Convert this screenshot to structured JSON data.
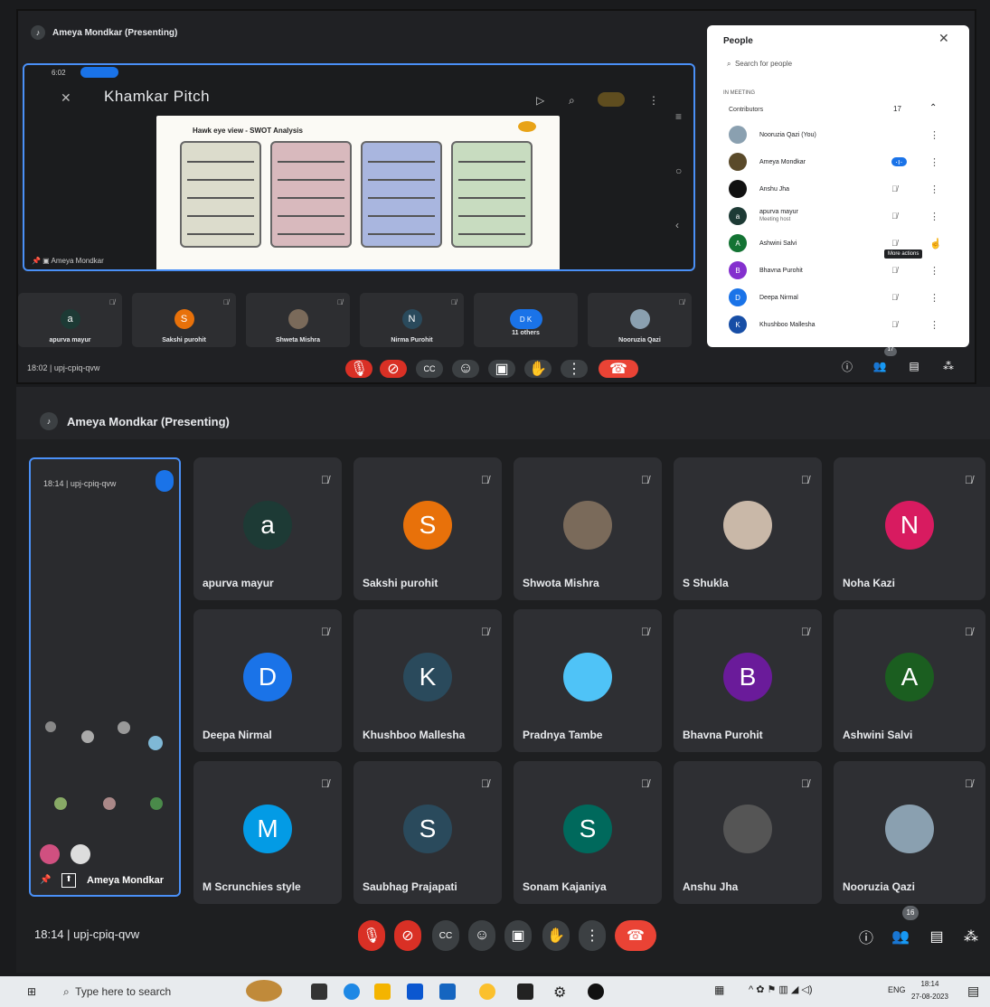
{
  "top": {
    "presenter_title": "Ameya Mondkar (Presenting)",
    "status_time": "6:02",
    "presentation_title": "Khamkar Pitch",
    "slide_title": "Hawk eye view - SWOT Analysis",
    "presenter_name": "Ameya Mondkar",
    "meeting_info": "18:02 | upj-cpiq-qvw",
    "tiles": [
      {
        "name": "apurva mayur",
        "initial": "a",
        "color": "#1d3a35"
      },
      {
        "name": "Sakshi purohit",
        "initial": "S",
        "color": "#e8710a"
      },
      {
        "name": "Shweta Mishra",
        "initial": "",
        "color": "#7a6a5a"
      },
      {
        "name": "Nirma Purohit",
        "initial": "N",
        "color": "#2a4a5c"
      },
      {
        "name": "11 others",
        "initial": "D K",
        "color": "#1a73e8"
      },
      {
        "name": "Nooruzia Qazi",
        "initial": "",
        "color": "#8aa0b0"
      }
    ],
    "people_count": "17"
  },
  "people": {
    "title": "People",
    "search_placeholder": "Search for people",
    "section": "IN MEETING",
    "group": "Contributors",
    "count": "17",
    "tooltip": "More actions",
    "rows": [
      {
        "name": "Nooruzia Qazi (You)",
        "initial": "",
        "color": "#8aa0b0"
      },
      {
        "name": "Ameya Mondkar",
        "initial": "",
        "color": "#5a4a2a"
      },
      {
        "name": "Anshu Jha",
        "initial": "",
        "color": "#111111"
      },
      {
        "name": "apurva mayur",
        "initial": "a",
        "color": "#1d3a35",
        "sub": "Meeting host"
      },
      {
        "name": "Ashwini Salvi",
        "initial": "A",
        "color": "#137333"
      },
      {
        "name": "Bhavna Purohit",
        "initial": "B",
        "color": "#8430ce"
      },
      {
        "name": "Deepa Nirmal",
        "initial": "D",
        "color": "#1a73e8"
      },
      {
        "name": "Khushboo Mallesha",
        "initial": "K",
        "color": "#174ea6"
      }
    ]
  },
  "bottom": {
    "presenter_title": "Ameya Mondkar (Presenting)",
    "screen_owner": "Ameya Mondkar",
    "meeting_info": "18:14 | upj-cpiq-qvw",
    "people_count": "16",
    "tiles": [
      {
        "name": "apurva mayur",
        "initial": "a",
        "color": "#1d3a35"
      },
      {
        "name": "Sakshi purohit",
        "initial": "S",
        "color": "#e8710a"
      },
      {
        "name": "Shwota Mishra",
        "initial": "",
        "color": "#7a6a5a"
      },
      {
        "name": "S Shukla",
        "initial": "",
        "color": "#c9b8a8"
      },
      {
        "name": "Noha Kazi",
        "initial": "N",
        "color": "#d81b60"
      },
      {
        "name": "Deepa Nirmal",
        "initial": "D",
        "color": "#1a73e8"
      },
      {
        "name": "Khushboo Mallesha",
        "initial": "K",
        "color": "#2a4a5c"
      },
      {
        "name": "Pradnya Tambe",
        "initial": "",
        "color": "#4fc3f7"
      },
      {
        "name": "Bhavna Purohit",
        "initial": "B",
        "color": "#6a1b9a"
      },
      {
        "name": "Ashwini Salvi",
        "initial": "A",
        "color": "#1b5e20"
      },
      {
        "name": "M Scrunchies style",
        "initial": "M",
        "color": "#039be5"
      },
      {
        "name": "Saubhag Prajapati",
        "initial": "S",
        "color": "#2a4a5c"
      },
      {
        "name": "Sonam Kajaniya",
        "initial": "S",
        "color": "#00695c"
      },
      {
        "name": "Anshu Jha",
        "initial": "",
        "color": "#555555"
      },
      {
        "name": "Nooruzia Qazi",
        "initial": "",
        "color": "#8aa0b0"
      }
    ]
  },
  "taskbar": {
    "search_placeholder": "Type here to search",
    "lang": "ENG",
    "time": "18:14",
    "date": "27-08-2023"
  }
}
